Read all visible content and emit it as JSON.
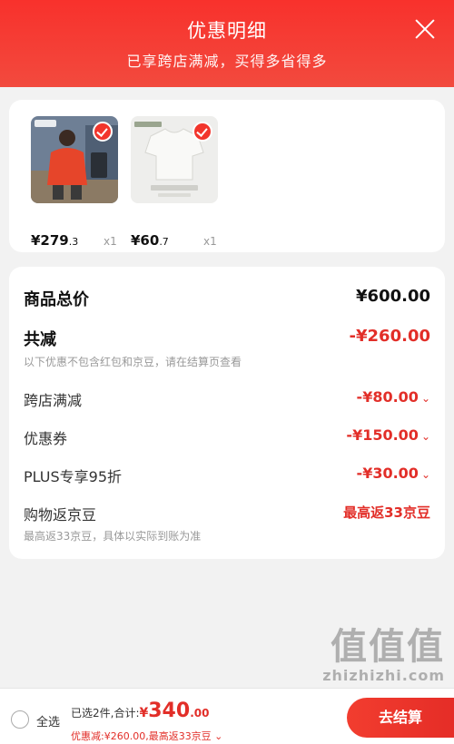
{
  "header": {
    "title": "优惠明细",
    "subtitle": "已享跨店满减，买得多省得多"
  },
  "products": [
    {
      "price_main": "¥279",
      "price_decimal": ".3",
      "qty": "x1"
    },
    {
      "price_main": "¥60",
      "price_decimal": ".7",
      "qty": "x1"
    }
  ],
  "detail": {
    "total_label": "商品总价",
    "total_value": "¥600.00",
    "reduce_label": "共减",
    "reduce_value": "-¥260.00",
    "reduce_note": "以下优惠不包含红包和京豆，请在结算页查看",
    "items": [
      {
        "label": "跨店满减",
        "value": "-¥80.00"
      },
      {
        "label": "优惠券",
        "value": "-¥150.00"
      },
      {
        "label": "PLUS专享95折",
        "value": "-¥30.00"
      }
    ],
    "beans_label": "购物返京豆",
    "beans_value": "最高返33京豆",
    "beans_note": "最高返33京豆，具体以实际到账为准"
  },
  "bottom": {
    "select_all": "全选",
    "summary_prefix": "已选2件,合计:",
    "yen": "¥",
    "amount": "340",
    "amount_decimal": ".00",
    "discount": "优惠减:¥260.00,最高返33京豆",
    "checkout": "去结算"
  },
  "watermark": {
    "big": "值值值",
    "small": "zhizhizhi.com"
  },
  "colors": {
    "accent": "#f2352c",
    "header_gradient_top": "#f8312c",
    "price_red": "#e22e28"
  }
}
